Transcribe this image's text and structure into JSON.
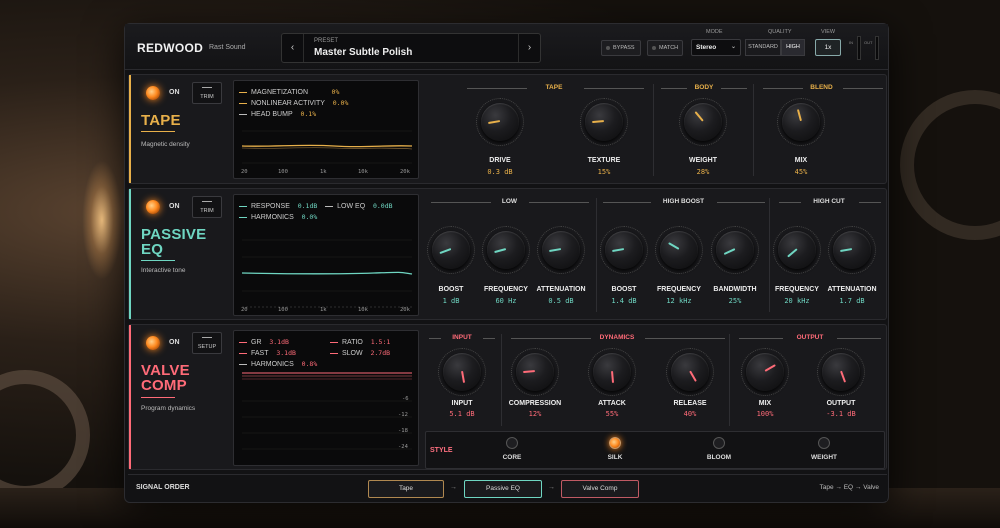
{
  "header": {
    "brand": "REDWOOD",
    "brand_sub": "Rast Sound",
    "preset_label": "PRESET",
    "preset_name": "Master Subtle Polish",
    "prev_icon": "‹",
    "next_icon": "›",
    "bypass_label": "BYPASS",
    "match_label": "MATCH",
    "mode_label": "MODE",
    "mode_value": "Stereo",
    "quality_label": "QUALITY",
    "quality_options": [
      "STANDARD",
      "HIGH"
    ],
    "quality_selected": "HIGH",
    "view_label": "VIEW",
    "view_value": "1x",
    "meter_in": "IN",
    "meter_out": "OUT"
  },
  "tape": {
    "on_label": "ON",
    "button": "TRIM",
    "title": "TAPE",
    "subtitle": "Magnetic density",
    "color": "#e8b04a",
    "readouts": [
      {
        "key": "MAGNETIZATION",
        "value": "0%"
      },
      {
        "key": "NONLINEAR ACTIVITY",
        "value": "0.0%"
      },
      {
        "key": "HEAD BUMP",
        "value": "0.1%"
      }
    ],
    "axis": [
      "20",
      "100",
      "1k",
      "10k",
      "20k"
    ],
    "groups": [
      {
        "label": "TAPE",
        "knobs": [
          {
            "name": "DRIVE",
            "value": "0.3 dB",
            "angle": -100
          },
          {
            "name": "TEXTURE",
            "value": "15%",
            "angle": -95
          }
        ]
      },
      {
        "label": "BODY",
        "knobs": [
          {
            "name": "WEIGHT",
            "value": "28%",
            "angle": -40
          }
        ]
      },
      {
        "label": "BLEND",
        "knobs": [
          {
            "name": "MIX",
            "value": "45%",
            "angle": -15
          }
        ]
      }
    ]
  },
  "eq": {
    "on_label": "ON",
    "button": "TRIM",
    "title_line1": "PASSIVE",
    "title_line2": "EQ",
    "subtitle": "Interactive tone",
    "color": "#6fd6c2",
    "readouts": [
      {
        "key": "RESPONSE",
        "value": "0.1dB"
      },
      {
        "key": "LOW EQ",
        "value": "0.0dB"
      },
      {
        "key": "HARMONICS",
        "value": "0.0%"
      }
    ],
    "axis": [
      "20",
      "100",
      "1k",
      "10k",
      "20k"
    ],
    "groups": [
      {
        "label": "LOW",
        "knobs": [
          {
            "name": "BOOST",
            "value": "1 dB",
            "angle": -110
          },
          {
            "name": "FREQUENCY",
            "value": "60 Hz",
            "angle": -105
          },
          {
            "name": "ATTENUATION",
            "value": "0.5 dB",
            "angle": -100
          }
        ]
      },
      {
        "label": "HIGH BOOST",
        "knobs": [
          {
            "name": "BOOST",
            "value": "1.4 dB",
            "angle": -100
          },
          {
            "name": "FREQUENCY",
            "value": "12 kHz",
            "angle": -60
          },
          {
            "name": "BANDWIDTH",
            "value": "25%",
            "angle": -115
          }
        ]
      },
      {
        "label": "HIGH CUT",
        "knobs": [
          {
            "name": "FREQUENCY",
            "value": "20 kHz",
            "angle": -130
          },
          {
            "name": "ATTENUATION",
            "value": "1.7 dB",
            "angle": -100
          }
        ]
      }
    ]
  },
  "comp": {
    "on_label": "ON",
    "button": "SETUP",
    "title_line1": "VALVE",
    "title_line2": "COMP",
    "subtitle": "Program dynamics",
    "color": "#ff6b78",
    "readouts": [
      {
        "key": "GR",
        "value": "3.1dB"
      },
      {
        "key": "RATIO",
        "value": "1.5:1"
      },
      {
        "key": "FAST",
        "value": "3.1dB"
      },
      {
        "key": "SLOW",
        "value": "2.7dB"
      },
      {
        "key": "HARMONICS",
        "value": "0.8%"
      }
    ],
    "axis": [
      "-6",
      "-12",
      "-18",
      "-24"
    ],
    "groups": [
      {
        "label": "INPUT",
        "knobs": [
          {
            "name": "INPUT",
            "value": "5.1 dB",
            "angle": 170
          }
        ]
      },
      {
        "label": "DYNAMICS",
        "knobs": [
          {
            "name": "COMPRESSION",
            "value": "12%",
            "angle": -95
          },
          {
            "name": "ATTACK",
            "value": "55%",
            "angle": 175
          },
          {
            "name": "RELEASE",
            "value": "40%",
            "angle": 150
          }
        ]
      },
      {
        "label": "OUTPUT",
        "knobs": [
          {
            "name": "MIX",
            "value": "100%",
            "angle": 60
          },
          {
            "name": "OUTPUT",
            "value": "-3.1 dB",
            "angle": 160
          }
        ]
      }
    ],
    "style_label": "STYLE",
    "styles": [
      "CORE",
      "SILK",
      "BLOOM",
      "WEIGHT"
    ],
    "style_selected": "SILK"
  },
  "footer": {
    "title": "SIGNAL ORDER",
    "chain": [
      "Tape",
      "Passive EQ",
      "Valve Comp"
    ],
    "arrow": "→",
    "summary": "Tape → EQ → Valve"
  }
}
